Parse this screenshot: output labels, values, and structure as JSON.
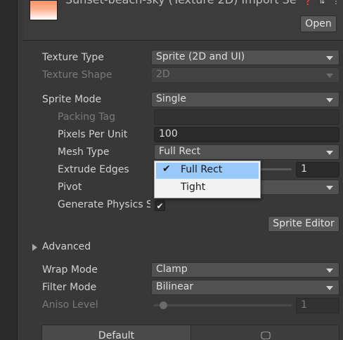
{
  "header": {
    "title": "Sunset-beach-sky (Texture 2D) Import Se",
    "open_label": "Open",
    "icons": [
      "help-icon",
      "preset-icon",
      "more-options-icon"
    ]
  },
  "texture_type": {
    "label": "Texture Type",
    "value": "Sprite (2D and UI)"
  },
  "texture_shape": {
    "label": "Texture Shape",
    "value": "2D"
  },
  "sprite_mode": {
    "label": "Sprite Mode",
    "value": "Single"
  },
  "packing_tag": {
    "label": "Packing Tag",
    "value": ""
  },
  "pixels_per_unit": {
    "label": "Pixels Per Unit",
    "value": "100"
  },
  "mesh_type": {
    "label": "Mesh Type",
    "value": "Full Rect",
    "options": [
      {
        "label": "Full Rect",
        "selected": true
      },
      {
        "label": "Tight",
        "selected": false
      }
    ]
  },
  "extrude_edges": {
    "label": "Extrude Edges",
    "value": "1"
  },
  "pivot": {
    "label": "Pivot",
    "value": ""
  },
  "generate_physics": {
    "label": "Generate Physics S",
    "checked": true
  },
  "sprite_editor": {
    "label": "Sprite Editor"
  },
  "advanced": {
    "label": "Advanced"
  },
  "wrap_mode": {
    "label": "Wrap Mode",
    "value": "Clamp"
  },
  "filter_mode": {
    "label": "Filter Mode",
    "value": "Bilinear"
  },
  "aniso_level": {
    "label": "Aniso Level",
    "value": "1"
  },
  "platform_tabs": [
    {
      "label": "Default",
      "active": true
    },
    {
      "label": "",
      "icon": "monitor-icon",
      "active": false
    }
  ],
  "colors": {
    "background": "#383838",
    "field": "#515151",
    "popup_selection": "#99c9f8"
  }
}
